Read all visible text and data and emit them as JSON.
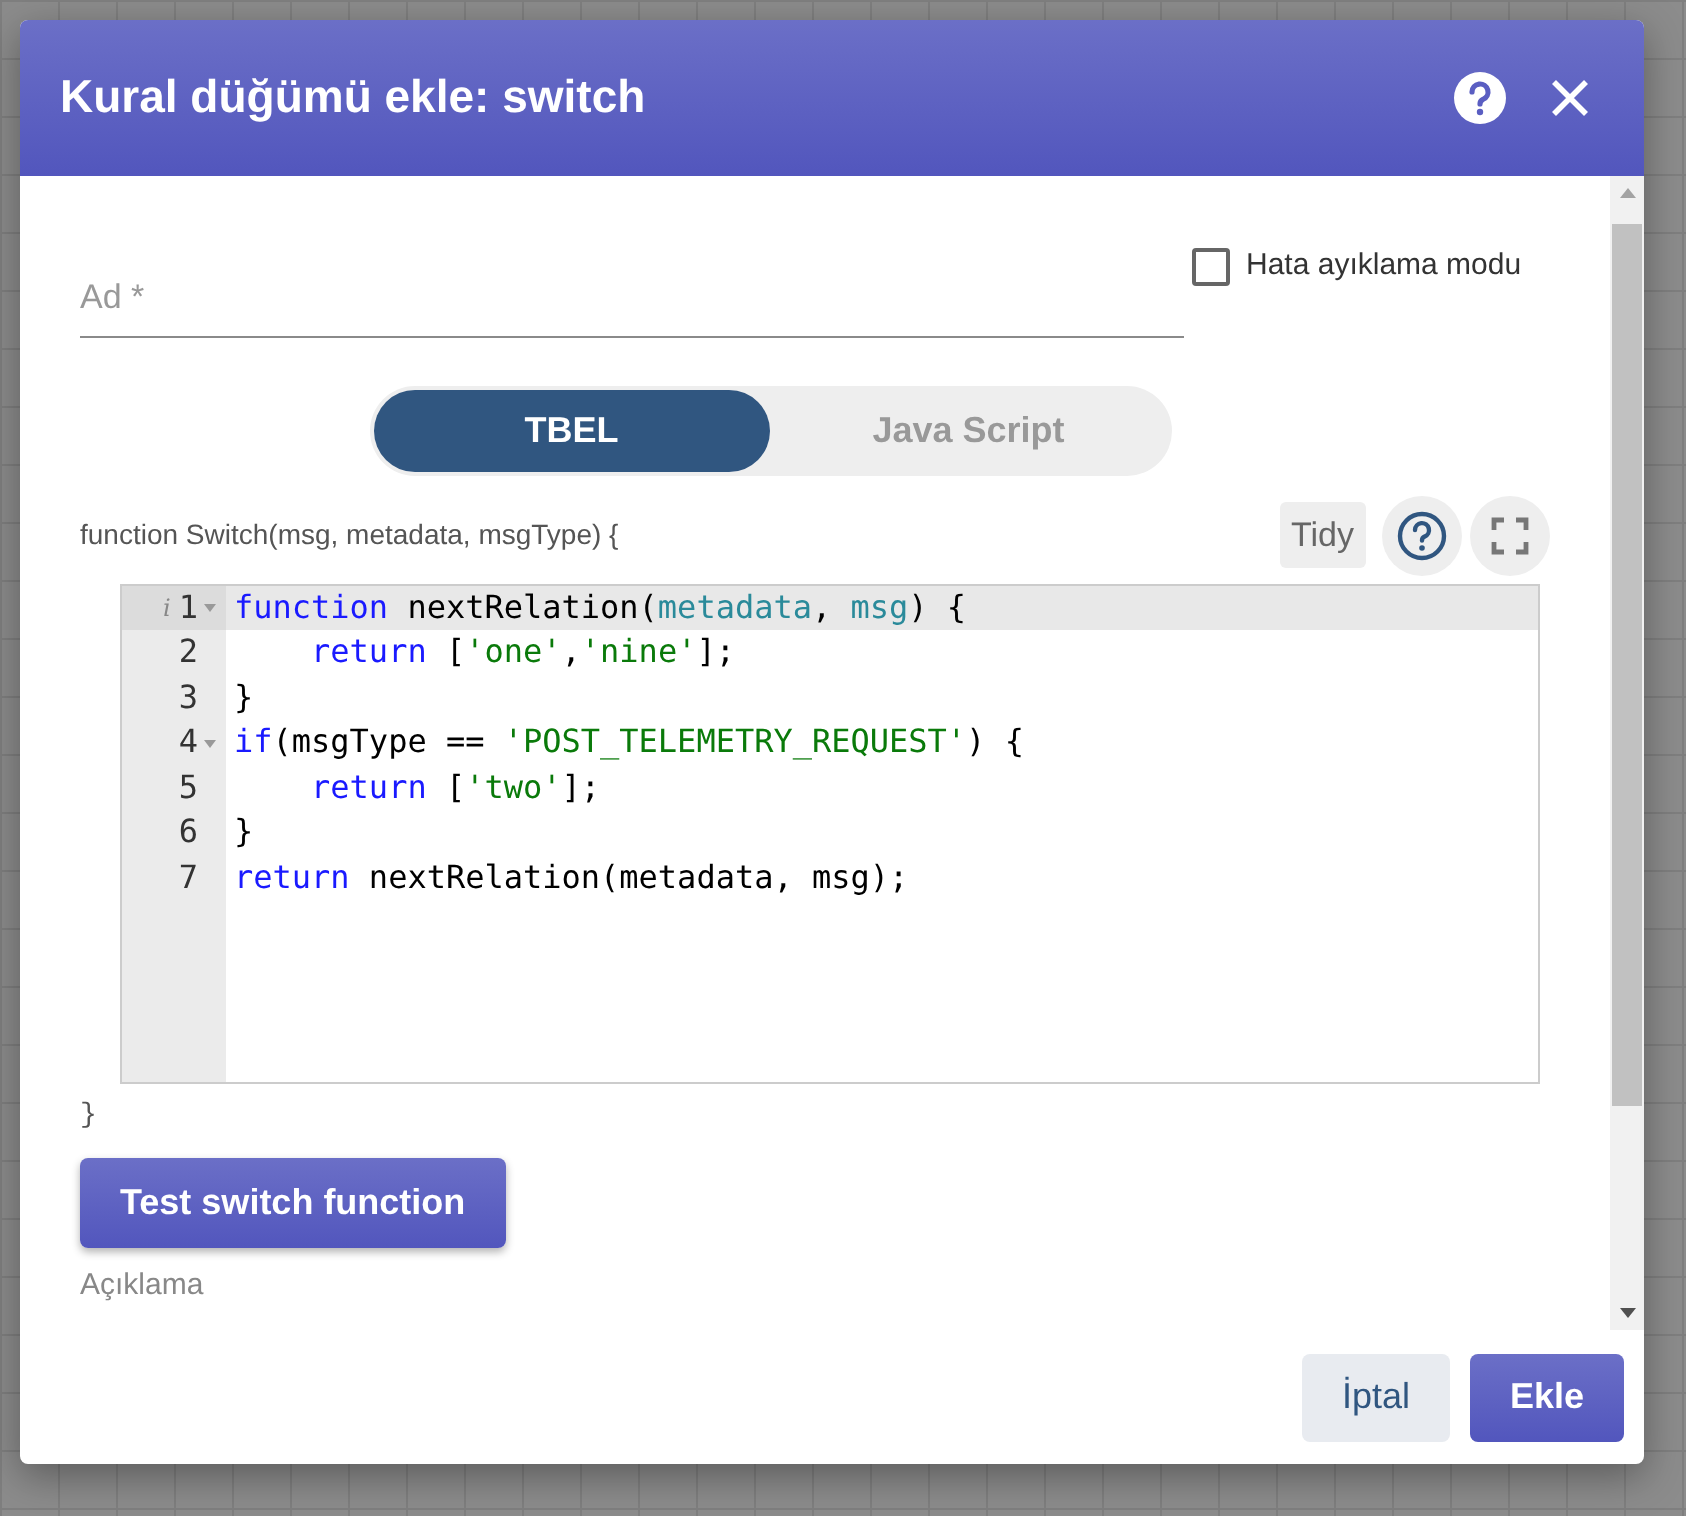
{
  "dialog": {
    "title": "Kural düğümü ekle: switch"
  },
  "form": {
    "name_field": {
      "placeholder": "Ad *"
    },
    "debug_mode": {
      "label": "Hata ayıklama modu",
      "checked": false
    },
    "language_tabs": [
      {
        "label": "TBEL",
        "selected": true
      },
      {
        "label": "Java Script",
        "selected": false
      }
    ],
    "function_header": "function Switch(msg, metadata, msgType) {",
    "tidy_button": "Tidy",
    "editor": {
      "lines": [
        {
          "number": "1",
          "active": true,
          "foldable": true,
          "marker": "i",
          "tokens": [
            {
              "kind": "keyword",
              "text": "function"
            },
            {
              "kind": "plain",
              "text": " nextRelation("
            },
            {
              "kind": "param",
              "text": "metadata"
            },
            {
              "kind": "plain",
              "text": ", "
            },
            {
              "kind": "param",
              "text": "msg"
            },
            {
              "kind": "plain",
              "text": ") {"
            }
          ]
        },
        {
          "number": "2",
          "active": false,
          "foldable": false,
          "indent": true,
          "tokens": [
            {
              "kind": "keyword",
              "text": "return"
            },
            {
              "kind": "plain",
              "text": " ["
            },
            {
              "kind": "string",
              "text": "'one'"
            },
            {
              "kind": "plain",
              "text": ","
            },
            {
              "kind": "string",
              "text": "'nine'"
            },
            {
              "kind": "plain",
              "text": "];"
            }
          ]
        },
        {
          "number": "3",
          "active": false,
          "foldable": false,
          "tokens": [
            {
              "kind": "plain",
              "text": "}"
            }
          ]
        },
        {
          "number": "4",
          "active": false,
          "foldable": true,
          "tokens": [
            {
              "kind": "keyword",
              "text": "if"
            },
            {
              "kind": "plain",
              "text": "(msgType == "
            },
            {
              "kind": "string",
              "text": "'POST_TELEMETRY_REQUEST'"
            },
            {
              "kind": "plain",
              "text": ") {"
            }
          ]
        },
        {
          "number": "5",
          "active": false,
          "foldable": false,
          "indent": true,
          "tokens": [
            {
              "kind": "keyword",
              "text": "return"
            },
            {
              "kind": "plain",
              "text": " ["
            },
            {
              "kind": "string",
              "text": "'two'"
            },
            {
              "kind": "plain",
              "text": "];"
            }
          ]
        },
        {
          "number": "6",
          "active": false,
          "foldable": false,
          "tokens": [
            {
              "kind": "plain",
              "text": "}"
            }
          ]
        },
        {
          "number": "7",
          "active": false,
          "foldable": false,
          "tokens": [
            {
              "kind": "keyword",
              "text": "return"
            },
            {
              "kind": "plain",
              "text": " nextRelation(metadata, msg);"
            }
          ]
        }
      ]
    },
    "function_footer": "}",
    "test_button": "Test switch function",
    "description_label": "Açıklama"
  },
  "buttons": [
    {
      "label": "İptal",
      "kind": "secondary"
    },
    {
      "label": "Ekle",
      "kind": "primary"
    }
  ]
}
